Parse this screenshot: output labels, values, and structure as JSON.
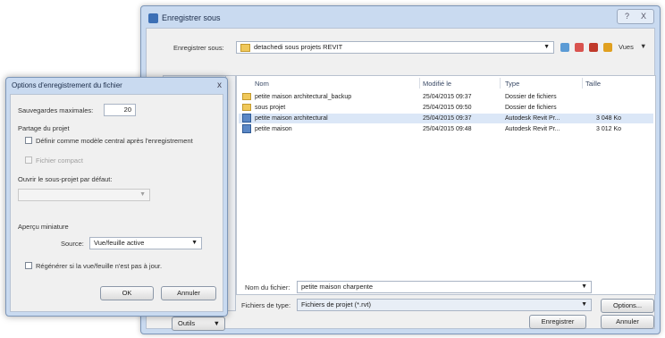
{
  "save_dialog": {
    "title": "Enregistrer sous",
    "close_label": "X",
    "help_label": "?",
    "save_in_label": "Enregistrer sous:",
    "save_in_value": "detachedi sous projets REVIT",
    "view_label": "Vues",
    "places_label": "Outils",
    "columns": [
      "Nom",
      "Modifié le",
      "Type",
      "Taille"
    ],
    "files": [
      {
        "name": "petite maison architectural_backup",
        "modified": "25/04/2015 09:37",
        "type": "Dossier de fichiers",
        "size": "",
        "icon": "folder-icon",
        "selected": false
      },
      {
        "name": "sous projet",
        "modified": "25/04/2015 09:50",
        "type": "Dossier de fichiers",
        "size": "",
        "icon": "folder-icon",
        "selected": false
      },
      {
        "name": "petite maison architectural",
        "modified": "25/04/2015 09:37",
        "type": "Autodesk Revit Pr...",
        "size": "3 048 Ko",
        "icon": "revit-file-icon",
        "selected": true
      },
      {
        "name": "petite maison",
        "modified": "25/04/2015 09:48",
        "type": "Autodesk Revit Pr...",
        "size": "3 012 Ko",
        "icon": "revit-file-icon",
        "selected": false
      }
    ],
    "filename_label": "Nom du fichier:",
    "filename_value": "petite maison charpente",
    "filetype_label": "Fichiers de type:",
    "filetype_value": "Fichiers de projet (*.rvt)",
    "options_button": "Options...",
    "save_button": "Enregistrer",
    "cancel_button": "Annuler"
  },
  "options_dialog": {
    "title": "Options d'enregistrement du fichier",
    "close_label": "x",
    "max_backups_label": "Sauvegardes maximales:",
    "max_backups_value": "20",
    "worksharing_label": "Partage du projet",
    "make_central_label": "Définir comme modèle central après l'enregistrement",
    "compact_label": "Fichier compact",
    "open_worksets_label": "Ouvrir le sous-projet par défaut:",
    "open_worksets_value": "",
    "thumbnail_label": "Aperçu miniature",
    "source_label": "Source:",
    "source_value": "Vue/feuille active",
    "regen_label": "Régénérer si la vue/feuille n'est pas à jour.",
    "ok_button": "OK",
    "cancel_button": "Annuler"
  }
}
